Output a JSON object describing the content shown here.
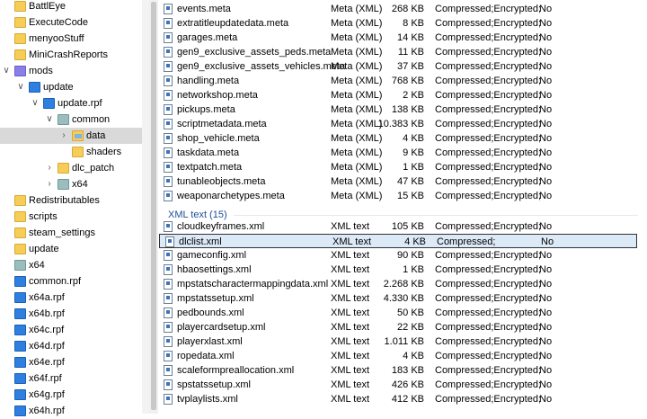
{
  "tree": [
    {
      "label": "BattlEye",
      "icon": "folder",
      "indent": 0,
      "chevron": ""
    },
    {
      "label": "ExecuteCode",
      "icon": "folder",
      "indent": 0,
      "chevron": ""
    },
    {
      "label": "menyooStuff",
      "icon": "folder",
      "indent": 0,
      "chevron": ""
    },
    {
      "label": "MiniCrashReports",
      "icon": "folder",
      "indent": 0,
      "chevron": ""
    },
    {
      "label": "mods",
      "icon": "mods",
      "indent": 0,
      "chevron": "down"
    },
    {
      "label": "update",
      "icon": "rpf",
      "indent": 1,
      "chevron": "down"
    },
    {
      "label": "update.rpf",
      "icon": "rpf",
      "indent": 2,
      "chevron": "down"
    },
    {
      "label": "common",
      "icon": "rpf-grey",
      "indent": 3,
      "chevron": "down"
    },
    {
      "label": "data",
      "icon": "dataopen",
      "indent": 4,
      "chevron": "right",
      "selected": true
    },
    {
      "label": "shaders",
      "icon": "folder",
      "indent": 4,
      "chevron": ""
    },
    {
      "label": "dlc_patch",
      "icon": "folder",
      "indent": 3,
      "chevron": "right"
    },
    {
      "label": "x64",
      "icon": "rpf-grey",
      "indent": 3,
      "chevron": "right"
    },
    {
      "label": "Redistributables",
      "icon": "folder",
      "indent": 0,
      "chevron": ""
    },
    {
      "label": "scripts",
      "icon": "folder",
      "indent": 0,
      "chevron": ""
    },
    {
      "label": "steam_settings",
      "icon": "folder",
      "indent": 0,
      "chevron": ""
    },
    {
      "label": "update",
      "icon": "folder",
      "indent": 0,
      "chevron": ""
    },
    {
      "label": "x64",
      "icon": "rpf-grey",
      "indent": 0,
      "chevron": ""
    },
    {
      "label": "common.rpf",
      "icon": "rpf",
      "indent": 0,
      "chevron": ""
    },
    {
      "label": "x64a.rpf",
      "icon": "rpf",
      "indent": 0,
      "chevron": ""
    },
    {
      "label": "x64b.rpf",
      "icon": "rpf",
      "indent": 0,
      "chevron": ""
    },
    {
      "label": "x64c.rpf",
      "icon": "rpf",
      "indent": 0,
      "chevron": ""
    },
    {
      "label": "x64d.rpf",
      "icon": "rpf",
      "indent": 0,
      "chevron": ""
    },
    {
      "label": "x64e.rpf",
      "icon": "rpf",
      "indent": 0,
      "chevron": ""
    },
    {
      "label": "x64f.rpf",
      "icon": "rpf",
      "indent": 0,
      "chevron": ""
    },
    {
      "label": "x64g.rpf",
      "icon": "rpf",
      "indent": 0,
      "chevron": ""
    },
    {
      "label": "x64h.rpf",
      "icon": "rpf",
      "indent": 0,
      "chevron": ""
    }
  ],
  "meta_files": [
    {
      "name": "events.meta",
      "type": "Meta (XML)",
      "size": "268 KB",
      "attr": "Compressed;Encrypted;",
      "enc": "No"
    },
    {
      "name": "extratitleupdatedata.meta",
      "type": "Meta (XML)",
      "size": "8 KB",
      "attr": "Compressed;Encrypted;",
      "enc": "No"
    },
    {
      "name": "garages.meta",
      "type": "Meta (XML)",
      "size": "14 KB",
      "attr": "Compressed;Encrypted;",
      "enc": "No"
    },
    {
      "name": "gen9_exclusive_assets_peds.meta",
      "type": "Meta (XML)",
      "size": "11 KB",
      "attr": "Compressed;Encrypted;",
      "enc": "No"
    },
    {
      "name": "gen9_exclusive_assets_vehicles.meta",
      "type": "Meta (XML)",
      "size": "37 KB",
      "attr": "Compressed;Encrypted;",
      "enc": "No"
    },
    {
      "name": "handling.meta",
      "type": "Meta (XML)",
      "size": "768 KB",
      "attr": "Compressed;Encrypted;",
      "enc": "No"
    },
    {
      "name": "networkshop.meta",
      "type": "Meta (XML)",
      "size": "2 KB",
      "attr": "Compressed;Encrypted;",
      "enc": "No"
    },
    {
      "name": "pickups.meta",
      "type": "Meta (XML)",
      "size": "138 KB",
      "attr": "Compressed;Encrypted;",
      "enc": "No"
    },
    {
      "name": "scriptmetadata.meta",
      "type": "Meta (XML)",
      "size": "10.383 KB",
      "attr": "Compressed;Encrypted;",
      "enc": "No"
    },
    {
      "name": "shop_vehicle.meta",
      "type": "Meta (XML)",
      "size": "4 KB",
      "attr": "Compressed;Encrypted;",
      "enc": "No"
    },
    {
      "name": "taskdata.meta",
      "type": "Meta (XML)",
      "size": "9 KB",
      "attr": "Compressed;Encrypted;",
      "enc": "No"
    },
    {
      "name": "textpatch.meta",
      "type": "Meta (XML)",
      "size": "1 KB",
      "attr": "Compressed;Encrypted;",
      "enc": "No"
    },
    {
      "name": "tunableobjects.meta",
      "type": "Meta (XML)",
      "size": "47 KB",
      "attr": "Compressed;Encrypted;",
      "enc": "No"
    },
    {
      "name": "weaponarchetypes.meta",
      "type": "Meta (XML)",
      "size": "15 KB",
      "attr": "Compressed;Encrypted;",
      "enc": "No"
    }
  ],
  "xml_group": {
    "label": "XML text (15)"
  },
  "xml_files": [
    {
      "name": "cloudkeyframes.xml",
      "type": "XML text",
      "size": "105 KB",
      "attr": "Compressed;Encrypted;",
      "enc": "No"
    },
    {
      "name": "dlclist.xml",
      "type": "XML text",
      "size": "4 KB",
      "attr": "Compressed;",
      "enc": "No",
      "selected": true
    },
    {
      "name": "gameconfig.xml",
      "type": "XML text",
      "size": "90 KB",
      "attr": "Compressed;Encrypted;",
      "enc": "No"
    },
    {
      "name": "hbaosettings.xml",
      "type": "XML text",
      "size": "1 KB",
      "attr": "Compressed;Encrypted;",
      "enc": "No"
    },
    {
      "name": "mpstatscharactermappingdata.xml",
      "type": "XML text",
      "size": "2.268 KB",
      "attr": "Compressed;Encrypted;",
      "enc": "No"
    },
    {
      "name": "mpstatssetup.xml",
      "type": "XML text",
      "size": "4.330 KB",
      "attr": "Compressed;Encrypted;",
      "enc": "No"
    },
    {
      "name": "pedbounds.xml",
      "type": "XML text",
      "size": "50 KB",
      "attr": "Compressed;Encrypted;",
      "enc": "No"
    },
    {
      "name": "playercardsetup.xml",
      "type": "XML text",
      "size": "22 KB",
      "attr": "Compressed;Encrypted;",
      "enc": "No"
    },
    {
      "name": "playerxlast.xml",
      "type": "XML text",
      "size": "1.011 KB",
      "attr": "Compressed;Encrypted;",
      "enc": "No"
    },
    {
      "name": "ropedata.xml",
      "type": "XML text",
      "size": "4 KB",
      "attr": "Compressed;Encrypted;",
      "enc": "No"
    },
    {
      "name": "scaleformpreallocation.xml",
      "type": "XML text",
      "size": "183 KB",
      "attr": "Compressed;Encrypted;",
      "enc": "No"
    },
    {
      "name": "spstatssetup.xml",
      "type": "XML text",
      "size": "426 KB",
      "attr": "Compressed;Encrypted;",
      "enc": "No"
    },
    {
      "name": "tvplaylists.xml",
      "type": "XML text",
      "size": "412 KB",
      "attr": "Compressed;Encrypted;",
      "enc": "No"
    }
  ]
}
